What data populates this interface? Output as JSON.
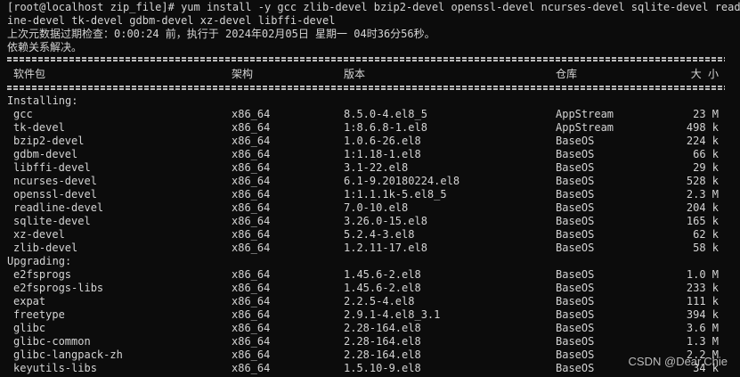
{
  "terminal": {
    "line1": "[root@localhost zip_file]# yum install -y gcc zlib-devel bzip2-devel openssl-devel ncurses-devel sqlite-devel readl",
    "line2": "ine-devel tk-devel gdbm-devel xz-devel libffi-devel",
    "line3": "上次元数据过期检查：0:00:24 前，执行于 2024年02月05日 星期一 04时36分56秒。",
    "line4": "依赖关系解决。"
  },
  "table": {
    "headers": {
      "package": "软件包",
      "arch": "架构",
      "version": "版本",
      "repo": "仓库",
      "size": "大 小"
    },
    "sections": [
      {
        "label": "Installing:",
        "rows": [
          {
            "pkg": "gcc",
            "arch": "x86_64",
            "ver": "8.5.0-4.el8_5",
            "repo": "AppStream",
            "size": "23 M"
          },
          {
            "pkg": "tk-devel",
            "arch": "x86_64",
            "ver": "1:8.6.8-1.el8",
            "repo": "AppStream",
            "size": "498 k"
          },
          {
            "pkg": "bzip2-devel",
            "arch": "x86_64",
            "ver": "1.0.6-26.el8",
            "repo": "BaseOS",
            "size": "224 k"
          },
          {
            "pkg": "gdbm-devel",
            "arch": "x86_64",
            "ver": "1:1.18-1.el8",
            "repo": "BaseOS",
            "size": "66 k"
          },
          {
            "pkg": "libffi-devel",
            "arch": "x86_64",
            "ver": "3.1-22.el8",
            "repo": "BaseOS",
            "size": "29 k"
          },
          {
            "pkg": "ncurses-devel",
            "arch": "x86_64",
            "ver": "6.1-9.20180224.el8",
            "repo": "BaseOS",
            "size": "528 k"
          },
          {
            "pkg": "openssl-devel",
            "arch": "x86_64",
            "ver": "1:1.1.1k-5.el8_5",
            "repo": "BaseOS",
            "size": "2.3 M"
          },
          {
            "pkg": "readline-devel",
            "arch": "x86_64",
            "ver": "7.0-10.el8",
            "repo": "BaseOS",
            "size": "204 k"
          },
          {
            "pkg": "sqlite-devel",
            "arch": "x86_64",
            "ver": "3.26.0-15.el8",
            "repo": "BaseOS",
            "size": "165 k"
          },
          {
            "pkg": "xz-devel",
            "arch": "x86_64",
            "ver": "5.2.4-3.el8",
            "repo": "BaseOS",
            "size": "62 k"
          },
          {
            "pkg": "zlib-devel",
            "arch": "x86_64",
            "ver": "1.2.11-17.el8",
            "repo": "BaseOS",
            "size": "58 k"
          }
        ]
      },
      {
        "label": "Upgrading:",
        "rows": [
          {
            "pkg": "e2fsprogs",
            "arch": "x86_64",
            "ver": "1.45.6-2.el8",
            "repo": "BaseOS",
            "size": "1.0 M"
          },
          {
            "pkg": "e2fsprogs-libs",
            "arch": "x86_64",
            "ver": "1.45.6-2.el8",
            "repo": "BaseOS",
            "size": "233 k"
          },
          {
            "pkg": "expat",
            "arch": "x86_64",
            "ver": "2.2.5-4.el8",
            "repo": "BaseOS",
            "size": "111 k"
          },
          {
            "pkg": "freetype",
            "arch": "x86_64",
            "ver": "2.9.1-4.el8_3.1",
            "repo": "BaseOS",
            "size": "394 k"
          },
          {
            "pkg": "glibc",
            "arch": "x86_64",
            "ver": "2.28-164.el8",
            "repo": "BaseOS",
            "size": "3.6 M"
          },
          {
            "pkg": "glibc-common",
            "arch": "x86_64",
            "ver": "2.28-164.el8",
            "repo": "BaseOS",
            "size": "1.3 M"
          },
          {
            "pkg": "glibc-langpack-zh",
            "arch": "x86_64",
            "ver": "2.28-164.el8",
            "repo": "BaseOS",
            "size": "2.2 M"
          },
          {
            "pkg": "keyutils-libs",
            "arch": "x86_64",
            "ver": "1.5.10-9.el8",
            "repo": "BaseOS",
            "size": "34 k"
          }
        ]
      }
    ]
  },
  "watermark": "CSDN @Dear.Chie",
  "colors": {
    "background": "#0c0c0c",
    "text": "#d4d4d4"
  }
}
